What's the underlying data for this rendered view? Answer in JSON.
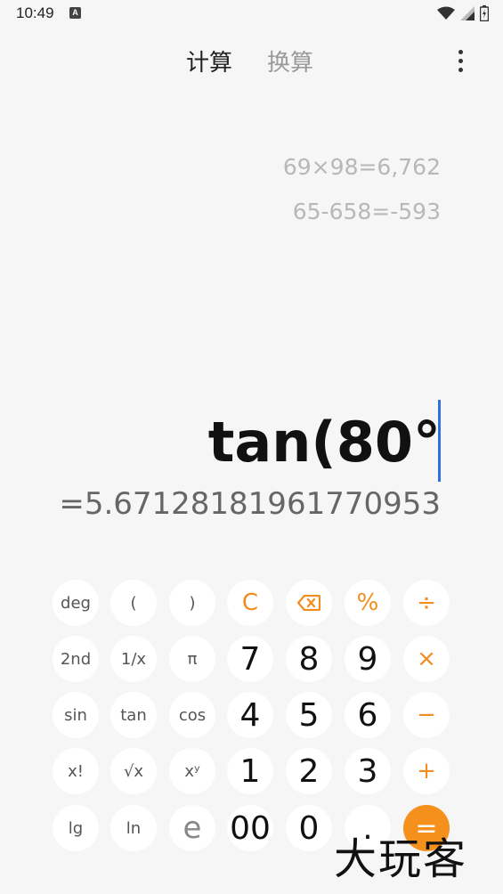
{
  "status_bar": {
    "time": "10:49",
    "app_icon_letter": "A",
    "icons": [
      "wifi-icon",
      "signal-icon",
      "battery-icon"
    ]
  },
  "tabs": [
    {
      "label": "计算",
      "active": true
    },
    {
      "label": "换算",
      "active": false
    }
  ],
  "menu_icon": "more-vert-icon",
  "history": [
    "69×98=6,762",
    "65-658=-593"
  ],
  "display": {
    "expression": "tan(80°",
    "result": "=5.67128181961770953"
  },
  "keys": {
    "row1": [
      "deg",
      "(",
      ")",
      "C",
      "⌫",
      "%",
      "÷"
    ],
    "row2": [
      "2nd",
      "1/x",
      "π",
      "7",
      "8",
      "9",
      "×"
    ],
    "row3": [
      "sin",
      "tan",
      "cos",
      "4",
      "5",
      "6",
      "−"
    ],
    "row4": [
      "x!",
      "√x",
      "xʸ",
      "1",
      "2",
      "3",
      "+"
    ],
    "row5": [
      "lg",
      "ln",
      "e",
      "00",
      "0",
      ".",
      "="
    ]
  },
  "colors": {
    "accent": "#f5901d",
    "cursor": "#2f6fe0"
  },
  "watermark": "大玩客"
}
